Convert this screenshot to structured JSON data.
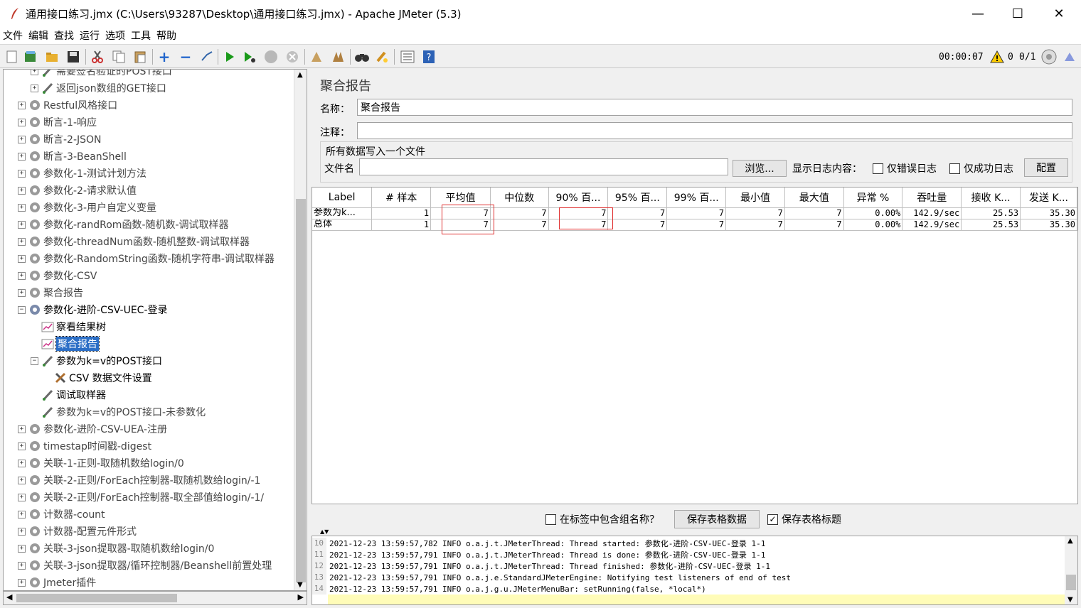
{
  "window": {
    "title": "通用接口练习.jmx (C:\\Users\\93287\\Desktop\\通用接口练习.jmx) - Apache JMeter (5.3)",
    "minimize": "—",
    "maximize": "☐",
    "close": "✕"
  },
  "menu": [
    "文件",
    "编辑",
    "查找",
    "运行",
    "选项",
    "工具",
    "帮助"
  ],
  "toolbar_status": {
    "timer": "00:00:07",
    "warnings": "0",
    "threads": "0/1"
  },
  "tree": {
    "items": [
      {
        "label": "需要签名验证的POST接口",
        "indent": 2,
        "icon": "sampler-icon",
        "exp": "+"
      },
      {
        "label": "返回json数组的GET接口",
        "indent": 2,
        "icon": "sampler-icon",
        "exp": "+"
      },
      {
        "label": "Restful风格接口",
        "indent": 1,
        "icon": "gear-icon",
        "exp": "+"
      },
      {
        "label": "断言-1-响应",
        "indent": 1,
        "icon": "gear-icon",
        "exp": "+"
      },
      {
        "label": "断言-2-JSON",
        "indent": 1,
        "icon": "gear-icon",
        "exp": "+"
      },
      {
        "label": "断言-3-BeanShell",
        "indent": 1,
        "icon": "gear-icon",
        "exp": "+"
      },
      {
        "label": "参数化-1-测试计划方法",
        "indent": 1,
        "icon": "gear-icon",
        "exp": "+"
      },
      {
        "label": "参数化-2-请求默认值",
        "indent": 1,
        "icon": "gear-icon",
        "exp": "+"
      },
      {
        "label": "参数化-3-用户自定义变量",
        "indent": 1,
        "icon": "gear-icon",
        "exp": "+"
      },
      {
        "label": "参数化-randRom函数-随机数-调试取样器",
        "indent": 1,
        "icon": "gear-icon",
        "exp": "+"
      },
      {
        "label": "参数化-threadNum函数-随机整数-调试取样器",
        "indent": 1,
        "icon": "gear-icon",
        "exp": "+"
      },
      {
        "label": "参数化-RandomString函数-随机字符串-调试取样器",
        "indent": 1,
        "icon": "gear-icon",
        "exp": "+"
      },
      {
        "label": "参数化-CSV",
        "indent": 1,
        "icon": "gear-icon",
        "exp": "+"
      },
      {
        "label": "聚合报告",
        "indent": 1,
        "icon": "gear-icon",
        "exp": "+"
      },
      {
        "label": "参数化-进阶-CSV-UEC-登录",
        "indent": 1,
        "icon": "gear-active-icon",
        "exp": "−",
        "dark": true
      },
      {
        "label": "察看结果树",
        "indent": 2,
        "icon": "chart-icon",
        "exp": "",
        "dark": true
      },
      {
        "label": "聚合报告",
        "indent": 2,
        "icon": "chart-icon",
        "exp": "",
        "selected": true
      },
      {
        "label": "参数为k=v的POST接口",
        "indent": 2,
        "icon": "sampler-icon",
        "exp": "−",
        "dark": true
      },
      {
        "label": "CSV 数据文件设置",
        "indent": 3,
        "icon": "tools-icon",
        "exp": "",
        "dark": true
      },
      {
        "label": "调试取样器",
        "indent": 2,
        "icon": "sampler-icon",
        "exp": "",
        "dark": true
      },
      {
        "label": "参数为k=v的POST接口-未参数化",
        "indent": 2,
        "icon": "sampler-icon",
        "exp": ""
      },
      {
        "label": "参数化-进阶-CSV-UEA-注册",
        "indent": 1,
        "icon": "gear-icon",
        "exp": "+"
      },
      {
        "label": "timestap时间戳-digest",
        "indent": 1,
        "icon": "gear-icon",
        "exp": "+"
      },
      {
        "label": "关联-1-正则-取随机数给login/0",
        "indent": 1,
        "icon": "gear-icon",
        "exp": "+"
      },
      {
        "label": "关联-2-正则/ForEach控制器-取随机数给login/-1",
        "indent": 1,
        "icon": "gear-icon",
        "exp": "+"
      },
      {
        "label": "关联-2-正则/ForEach控制器-取全部值给login/-1/",
        "indent": 1,
        "icon": "gear-icon",
        "exp": "+"
      },
      {
        "label": "计数器-count",
        "indent": 1,
        "icon": "gear-icon",
        "exp": "+"
      },
      {
        "label": "计数器-配置元件形式",
        "indent": 1,
        "icon": "gear-icon",
        "exp": "+"
      },
      {
        "label": "关联-3-json提取器-取随机数给login/0",
        "indent": 1,
        "icon": "gear-icon",
        "exp": "+"
      },
      {
        "label": "关联-3-json提取器/循环控制器/Beanshell前置处理",
        "indent": 1,
        "icon": "gear-icon",
        "exp": "+"
      },
      {
        "label": "Jmeter插件",
        "indent": 1,
        "icon": "gear-icon",
        "exp": "+"
      }
    ]
  },
  "report": {
    "title": "聚合报告",
    "name_label": "名称：",
    "name_value": "聚合报告",
    "comment_label": "注释：",
    "comment_value": "",
    "group_title": "所有数据写入一个文件",
    "file_label": "文件名",
    "file_value": "",
    "browse": "浏览...",
    "log_label": "显示日志内容：",
    "errors_only": "仅错误日志",
    "success_only": "仅成功日志",
    "configure": "配置",
    "columns": [
      "Label",
      "# 样本",
      "平均值",
      "中位数",
      "90% 百...",
      "95% 百...",
      "99% 百...",
      "最小值",
      "最大值",
      "异常 %",
      "吞吐量",
      "接收 K...",
      "发送 K..."
    ],
    "rows": [
      [
        "参数为k...",
        "1",
        "7",
        "7",
        "7",
        "7",
        "7",
        "7",
        "7",
        "0.00%",
        "142.9/sec",
        "25.53",
        "35.30"
      ],
      [
        "总体",
        "1",
        "7",
        "7",
        "7",
        "7",
        "7",
        "7",
        "7",
        "0.00%",
        "142.9/sec",
        "25.53",
        "35.30"
      ]
    ],
    "include_group": "在标签中包含组名称？",
    "save_table": "保存表格数据",
    "save_header": "保存表格标题"
  },
  "log": [
    {
      "no": "10",
      "text": "2021-12-23 13:59:57,782 INFO o.a.j.t.JMeterThread: Thread started: 参数化-进阶-CSV-UEC-登录 1-1"
    },
    {
      "no": "11",
      "text": "2021-12-23 13:59:57,791 INFO o.a.j.t.JMeterThread: Thread is done: 参数化-进阶-CSV-UEC-登录 1-1"
    },
    {
      "no": "12",
      "text": "2021-12-23 13:59:57,791 INFO o.a.j.t.JMeterThread: Thread finished: 参数化-进阶-CSV-UEC-登录 1-1"
    },
    {
      "no": "13",
      "text": "2021-12-23 13:59:57,791 INFO o.a.j.e.StandardJMeterEngine: Notifying test listeners of end of test"
    },
    {
      "no": "14",
      "text": "2021-12-23 13:59:57,791 INFO o.a.j.g.u.JMeterMenuBar: setRunning(false, *local*)"
    }
  ]
}
